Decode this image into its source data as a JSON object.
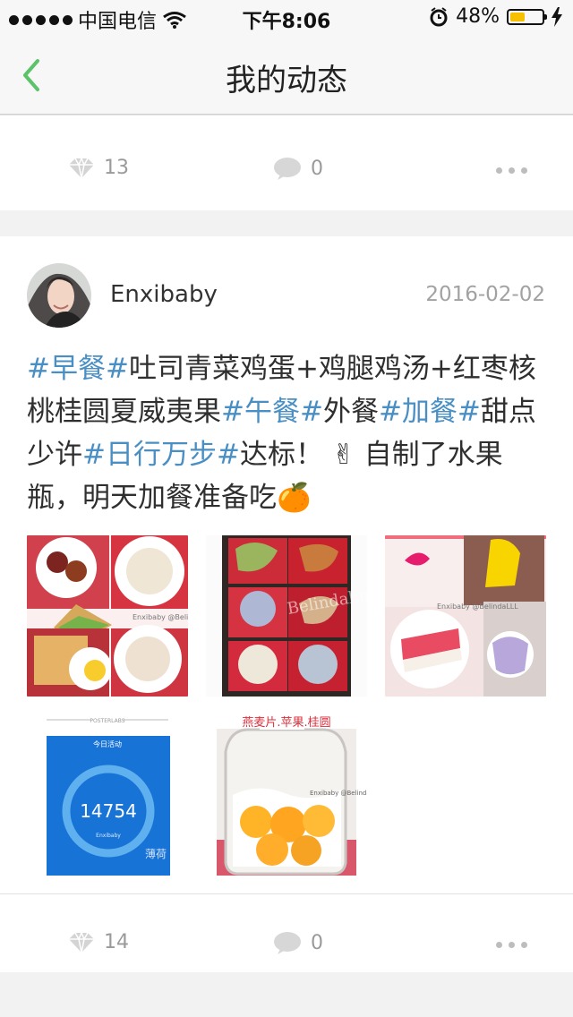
{
  "status_bar": {
    "carrier": "中国电信",
    "time": "下午8:06",
    "battery": "48%",
    "battery_level": 0.48,
    "icons": [
      "signal-icon",
      "wifi-icon",
      "alarm-icon",
      "battery-icon",
      "charging-icon"
    ]
  },
  "nav": {
    "title": "我的动态",
    "back_icon": "chevron-left-icon",
    "accent": "#5cc36a"
  },
  "previous_post": {
    "likes": "13",
    "comments": "0"
  },
  "post": {
    "username": "Enxibaby",
    "date": "2016-02-02",
    "segments": [
      {
        "text": "#早餐#",
        "type": "tag"
      },
      {
        "text": "吐司青菜鸡蛋+鸡腿鸡汤+红枣核桃桂圆夏威夷果",
        "type": "text"
      },
      {
        "text": "#午餐#",
        "type": "tag"
      },
      {
        "text": "外餐",
        "type": "text"
      },
      {
        "text": "#加餐#",
        "type": "tag"
      },
      {
        "text": "甜点少许",
        "type": "text"
      },
      {
        "text": "#日行万步#",
        "type": "tag"
      },
      {
        "text": "达标！ ✌ 自制了水果瓶，明天加餐准备吃🍊",
        "type": "text"
      }
    ],
    "photos": [
      {
        "caption": "Enxibaby @BelindaLLL"
      },
      {
        "caption": "Belindalinna"
      },
      {
        "caption": "Enxibaby @BelindaLLL"
      },
      {
        "caption": "POSTERLABS",
        "title": "今日活动",
        "steps": "14754",
        "user": "Enxibaby",
        "brand": "薄荷"
      },
      {
        "caption": "燕麦片.苹果.桂圆",
        "watermark": "Enxibaby @BelindaLLL"
      }
    ],
    "likes": "14",
    "comments": "0"
  },
  "colors": {
    "tag": "#4a8fc4",
    "background": "#f2f2f2",
    "gray": "#9a9a9a"
  }
}
